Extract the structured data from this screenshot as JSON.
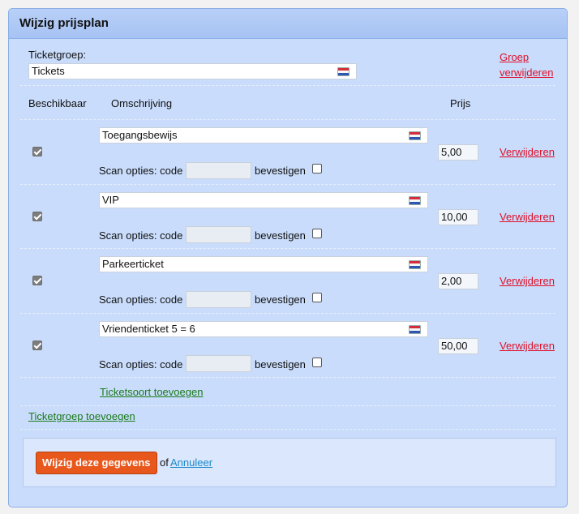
{
  "header": {
    "title": "Wijzig prijsplan"
  },
  "group": {
    "label": "Ticketgroep:",
    "value": "Tickets",
    "remove_link_line1": "Groep",
    "remove_link_line2": "verwijderen"
  },
  "columns": {
    "available": "Beschikbaar",
    "description": "Omschrijving",
    "price": "Prijs"
  },
  "rows": [
    {
      "available": true,
      "description": "Toegangsbewijs",
      "price": "5,00",
      "scan_label": "Scan opties: code",
      "code": "",
      "confirm_label": "bevestigen",
      "confirm": false,
      "remove_label": "Verwijderen"
    },
    {
      "available": true,
      "description": "VIP",
      "price": "10,00",
      "scan_label": "Scan opties: code",
      "code": "",
      "confirm_label": "bevestigen",
      "confirm": false,
      "remove_label": "Verwijderen"
    },
    {
      "available": true,
      "description": "Parkeerticket",
      "price": "2,00",
      "scan_label": "Scan opties: code",
      "code": "",
      "confirm_label": "bevestigen",
      "confirm": false,
      "remove_label": "Verwijderen"
    },
    {
      "available": true,
      "description": "Vriendenticket 5 = 6",
      "price": "50,00",
      "scan_label": "Scan opties: code",
      "code": "",
      "confirm_label": "bevestigen",
      "confirm": false,
      "remove_label": "Verwijderen"
    }
  ],
  "links": {
    "add_ticket_type": "Ticketsoort toevoegen",
    "add_ticket_group": "Ticketgroep toevoegen"
  },
  "footer": {
    "submit_label": "Wijzig deze gegevens",
    "or_text": "of",
    "cancel_label": "Annuleer"
  },
  "icons": {
    "flag": "dutch-flag-icon"
  },
  "colors": {
    "accent": "#e8571b",
    "link_red": "#e0102a",
    "link_green": "#1a7a1a",
    "link_blue": "#1a88c9"
  }
}
